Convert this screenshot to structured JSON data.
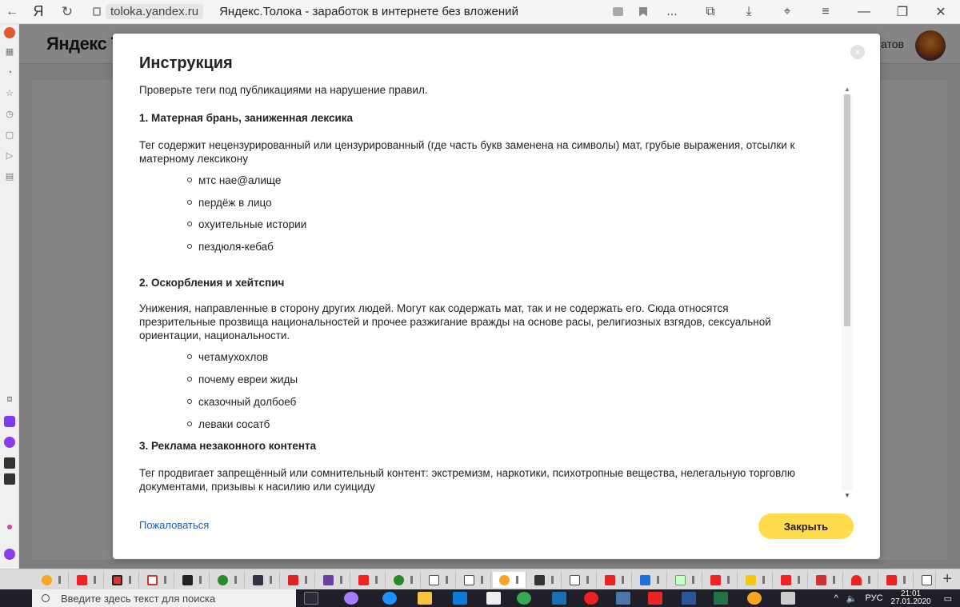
{
  "browser": {
    "back_icon": "back-arrow-icon",
    "logo": "Я",
    "domain": "toloka.yandex.ru",
    "tab_title": "Яндекс.Толока - заработок в интернете без вложений",
    "more": "...",
    "icons": [
      "collections-icon",
      "download-icon",
      "pin-icon",
      "menu-icon",
      "minimize-icon",
      "restore-icon",
      "close-icon"
    ]
  },
  "background_page": {
    "logo_text": "Яндекс Т",
    "header_right_text": "атов"
  },
  "modal": {
    "title": "Инструкция",
    "intro": "Проверьте теги под публикациями на нарушение правил.",
    "section1_heading": "1. Матерная брань, заниженная лексика",
    "section1_text_line1": "Тег содержит нецензурированный или цензурированный (где часть букв заменена на символы) мат, грубые выражения, отсылки к",
    "section1_text_line2": "матерному лексикону",
    "section1_items": [
      "мтс нае@алище",
      "пердёж в лицо",
      "охуительные истории",
      "пездюля-кебаб"
    ],
    "section2_heading": "2. Оскорбления и хейтспич",
    "section2_text_line1": "Унижения, направленные в сторону других людей. Могут как содержать мат, так и не содержать его. Сюда относятся",
    "section2_text_line2": "презрительные прозвища национальностей и прочее разжигание вражды на основе расы, религиозных взгядов, сексуальной",
    "section2_text_line3": "ориентации, национальности.",
    "section2_items": [
      "четамухохлов",
      "почему евреи жиды",
      "сказочный долбоеб",
      "леваки сосатб"
    ],
    "section3_heading": "3. Реклама незаконного контента",
    "section3_text_line1": "Тег продвигает запрещённый или сомнительный контент: экстремизм, наркотики, психотропные вещества, нелегальную торговлю",
    "section3_text_line2": "документами, призывы к насилию или суициду",
    "complain_link": "Пожаловаться",
    "close_button": "Закрыть",
    "close_x": "×"
  },
  "taskbar": {
    "search_placeholder": "Введите здесь текст для поиска",
    "lang": "РУС",
    "time": "21:01",
    "date": "27.01.2020"
  }
}
